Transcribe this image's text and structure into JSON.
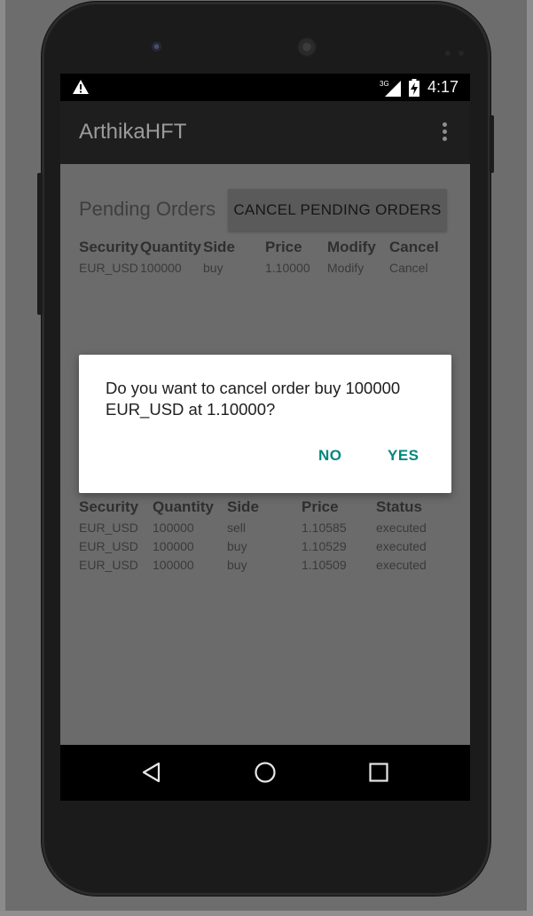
{
  "status_bar": {
    "time": "4:17",
    "network": "3G",
    "icons": [
      "warning-icon",
      "signal-icon",
      "battery-charging-icon"
    ]
  },
  "app_bar": {
    "title": "ArthikaHFT",
    "menu_icon": "overflow-menu-icon"
  },
  "pending_orders": {
    "title": "Pending Orders",
    "cancel_all_label": "CANCEL PENDING ORDERS",
    "columns": [
      "Security",
      "Quantity",
      "Side",
      "Price",
      "Modify",
      "Cancel"
    ],
    "rows": [
      {
        "security": "EUR_USD",
        "quantity": "100000",
        "side": "buy",
        "price": "1.10000",
        "modify": "Modify",
        "cancel": "Cancel"
      }
    ]
  },
  "executed_orders": {
    "columns": [
      "Security",
      "Quantity",
      "Side",
      "Price",
      "Status"
    ],
    "rows": [
      {
        "security": "EUR_USD",
        "quantity": "100000",
        "side": "sell",
        "price": "1.10585",
        "status": "executed"
      },
      {
        "security": "EUR_USD",
        "quantity": "100000",
        "side": "buy",
        "price": "1.10529",
        "status": "executed"
      },
      {
        "security": "EUR_USD",
        "quantity": "100000",
        "side": "buy",
        "price": "1.10509",
        "status": "executed"
      }
    ]
  },
  "dialog": {
    "message": "Do you want to cancel order buy 100000 EUR_USD at 1.10000?",
    "no_label": "NO",
    "yes_label": "YES"
  },
  "nav_bar": {
    "icons": [
      "back-icon",
      "home-icon",
      "recent-apps-icon"
    ]
  },
  "colors": {
    "accent": "#00897b",
    "app_bar": "#1e1e1e",
    "overlay_background": "#6b6b6b"
  }
}
